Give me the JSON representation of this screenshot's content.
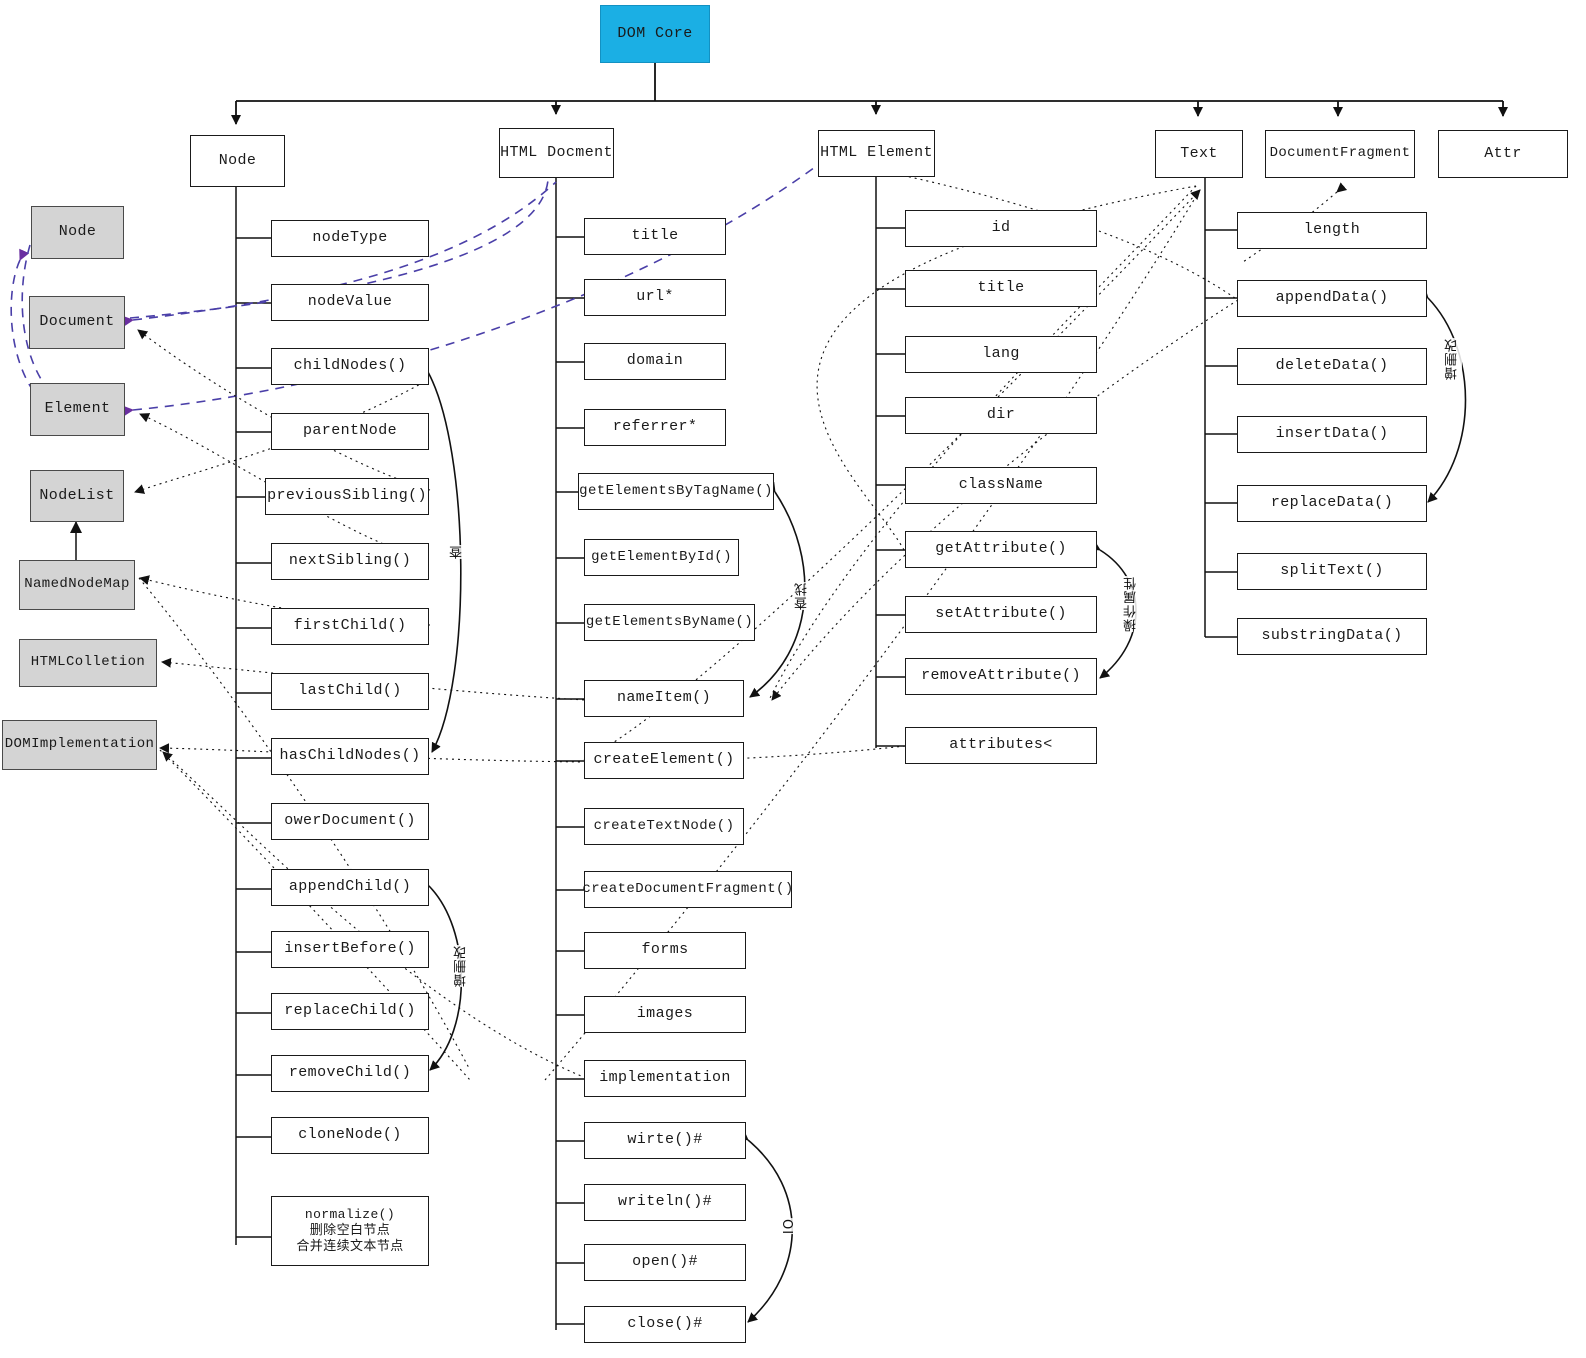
{
  "diagram": {
    "title": "DOM Core",
    "root": {
      "label": "DOM Core",
      "color": "#1BAFE4"
    },
    "level1": [
      {
        "label": "Node"
      },
      {
        "label": "HTML Docment"
      },
      {
        "label": "HTML Element"
      },
      {
        "label": "Text"
      },
      {
        "label": "DocumentFragment"
      },
      {
        "label": "Attr"
      }
    ],
    "interfaces": [
      {
        "label": "Node"
      },
      {
        "label": "Document"
      },
      {
        "label": "Element"
      },
      {
        "label": "NodeList"
      },
      {
        "label": "NamedNodeMap"
      },
      {
        "label": "HTMLColletion"
      },
      {
        "label": "DOMImplementation"
      }
    ],
    "node_members": [
      {
        "label": "nodeType"
      },
      {
        "label": "nodeValue"
      },
      {
        "label": "childNodes()"
      },
      {
        "label": "parentNode"
      },
      {
        "label": "previousSibling()"
      },
      {
        "label": "nextSibling()"
      },
      {
        "label": "firstChild()"
      },
      {
        "label": "lastChild()"
      },
      {
        "label": "hasChildNodes()"
      },
      {
        "label": "owerDocument()"
      },
      {
        "label": "appendChild()"
      },
      {
        "label": "insertBefore()"
      },
      {
        "label": "replaceChild()"
      },
      {
        "label": "removeChild()"
      },
      {
        "label": "cloneNode()"
      },
      {
        "label": "normalize()\n删除空白节点\n合并连续文本节点"
      }
    ],
    "document_members": [
      {
        "label": "title"
      },
      {
        "label": "url*"
      },
      {
        "label": "domain"
      },
      {
        "label": "referrer*"
      },
      {
        "label": "getElementsByTagName()"
      },
      {
        "label": "getElementById()"
      },
      {
        "label": "getElementsByName()"
      },
      {
        "label": "nameItem()"
      },
      {
        "label": "createElement()"
      },
      {
        "label": "createTextNode()"
      },
      {
        "label": "createDocumentFragment()"
      },
      {
        "label": "forms"
      },
      {
        "label": "images"
      },
      {
        "label": "implementation"
      },
      {
        "label": "wirte()#"
      },
      {
        "label": "writeln()#"
      },
      {
        "label": "open()#"
      },
      {
        "label": "close()#"
      }
    ],
    "element_members": [
      {
        "label": "id"
      },
      {
        "label": "title"
      },
      {
        "label": "lang"
      },
      {
        "label": "dir"
      },
      {
        "label": "className"
      },
      {
        "label": "getAttribute()"
      },
      {
        "label": "setAttribute()"
      },
      {
        "label": "removeAttribute()"
      },
      {
        "label": "attributes<"
      }
    ],
    "text_members": [
      {
        "label": "length"
      },
      {
        "label": "appendData()"
      },
      {
        "label": "deleteData()"
      },
      {
        "label": "insertData()"
      },
      {
        "label": "replaceData()"
      },
      {
        "label": "splitText()"
      },
      {
        "label": "substringData()"
      }
    ],
    "annotations": [
      {
        "label": "查",
        "name": "node-search-annotation"
      },
      {
        "label": "查找",
        "name": "document-search-annotation"
      },
      {
        "label": "操作属性",
        "name": "element-attribute-annotation"
      },
      {
        "label": "增删改",
        "name": "text-crud-annotation"
      },
      {
        "label": "增删改",
        "name": "node-crud-annotation"
      },
      {
        "label": "IO",
        "name": "document-io-annotation"
      }
    ]
  }
}
